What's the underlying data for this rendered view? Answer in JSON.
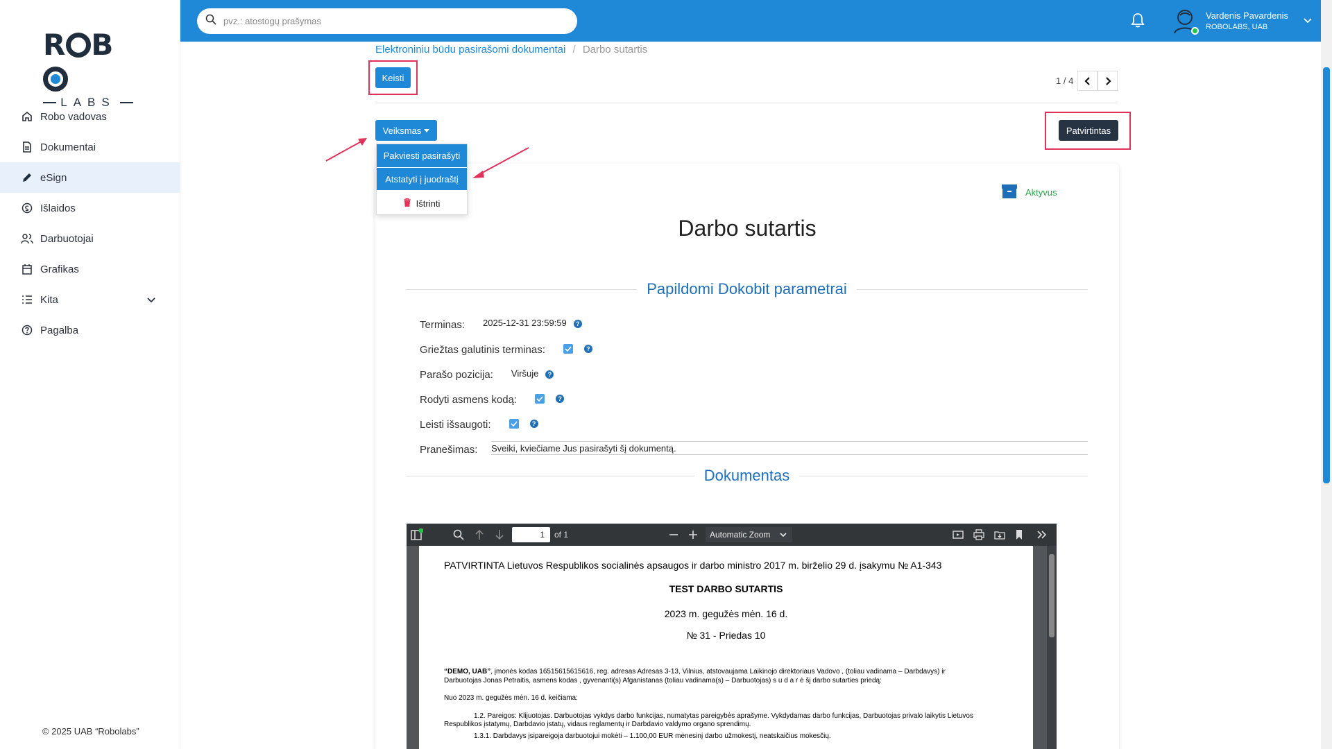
{
  "logo": {
    "top": "ROBO",
    "bottom": "LABS"
  },
  "sidebar": {
    "items": [
      {
        "label": "Robo vadovas",
        "icon": "home-icon"
      },
      {
        "label": "Dokumentai",
        "icon": "document-icon"
      },
      {
        "label": "eSign",
        "icon": "pen-icon",
        "active": true
      },
      {
        "label": "Išlaidos",
        "icon": "expenses-icon"
      },
      {
        "label": "Darbuotojai",
        "icon": "users-icon"
      },
      {
        "label": "Grafikas",
        "icon": "calendar-icon"
      },
      {
        "label": "Kita",
        "icon": "list-icon"
      },
      {
        "label": "Pagalba",
        "icon": "help-circle-icon"
      }
    ],
    "copyright": "© 2025 UAB “Robolabs”"
  },
  "topbar": {
    "search_placeholder": "pvz.: atostogų prašymas",
    "user_name": "Vardenis Pavardenis",
    "user_company": "ROBOLABS, UAB"
  },
  "breadcrumb": {
    "parent": "Elektroniniu būdu pasirašomi dokumentai",
    "current": "Darbo sutartis"
  },
  "toolbar": {
    "edit_label": "Keisti",
    "pager": "1 / 4",
    "action_label": "Veiksmas",
    "state_label": "Patvirtintas"
  },
  "dropdown": {
    "items": [
      "Pakviesti pasirašyti",
      "Atstatyti į juodraštį",
      "Ištrinti"
    ]
  },
  "document": {
    "status": "Aktyvus",
    "title": "Darbo sutartis",
    "section_params": "Papildomi Dokobit parametrai",
    "section_doc": "Dokumentas",
    "fields": {
      "deadline_label": "Terminas:",
      "deadline_value": "2025-12-31 23:59:59",
      "strict_label": "Griežtas galutinis terminas:",
      "sign_pos_label": "Parašo pozicija:",
      "sign_pos_value": "Viršuje",
      "show_code_label": "Rodyti asmens kodą:",
      "allow_save_label": "Leisti išsaugoti:",
      "message_label": "Pranešimas:",
      "message_value": "Sveiki, kviečiame Jus pasirašyti šį dokumentą."
    }
  },
  "pdf": {
    "page": "1",
    "of": "of 1",
    "zoom": "Automatic Zoom",
    "lines": {
      "approved": "PATVIRTINTA Lietuvos Respublikos socialinės apsaugos ir darbo ministro 2017 m. birželio 29 d. įsakymu № A1-343",
      "heading": "TEST DARBO SUTARTIS",
      "date": "2023 m. gegužės mėn. 16 d.",
      "number": "№ 31 - Priedas 10",
      "para1_bold": "“DEMO, UAB”",
      "para1": ", įmonės kodas 16515615615616, reg. adresas Adresas 3-13, Vilnius, atstovaujama Laikinojo direktoriaus Vadovo , (toliau vadinama – Darbdavys) ir",
      "para1b": "Darbuotojas Jonas Petraitis, asmens kodas , gyvenanti(s) Afganistanas (toliau vadinama(s) – Darbuotojas) s u d a r ė šį darbo sutarties priedą:",
      "para2": "Nuo 2023 m. gegužės mėn. 16 d. keičiama:",
      "para3": "1.2. Pareigos: Klijuotojas. Darbuotojas vykdys darbo funkcijas, numatytas pareigybės aprašyme. Vykdydamas darbo funkcijas, Darbuotojas privalo laikytis Lietuvos",
      "para3b": "Respublikos įstatymų, Darbdavio įstatų, vidaus reglamentų ir Darbdavio valdymo organo sprendimų.",
      "para4": "1.3.1. Darbdavys įsipareigoja darbuotojui mokėti – 1.100,00 EUR mėnesinį darbo užmokestį, neatskaičius mokesčių."
    }
  },
  "colors": {
    "primary": "#1f89d8",
    "dark_button": "#263342",
    "highlight": "#e0325a",
    "active_status": "#27a34a"
  }
}
